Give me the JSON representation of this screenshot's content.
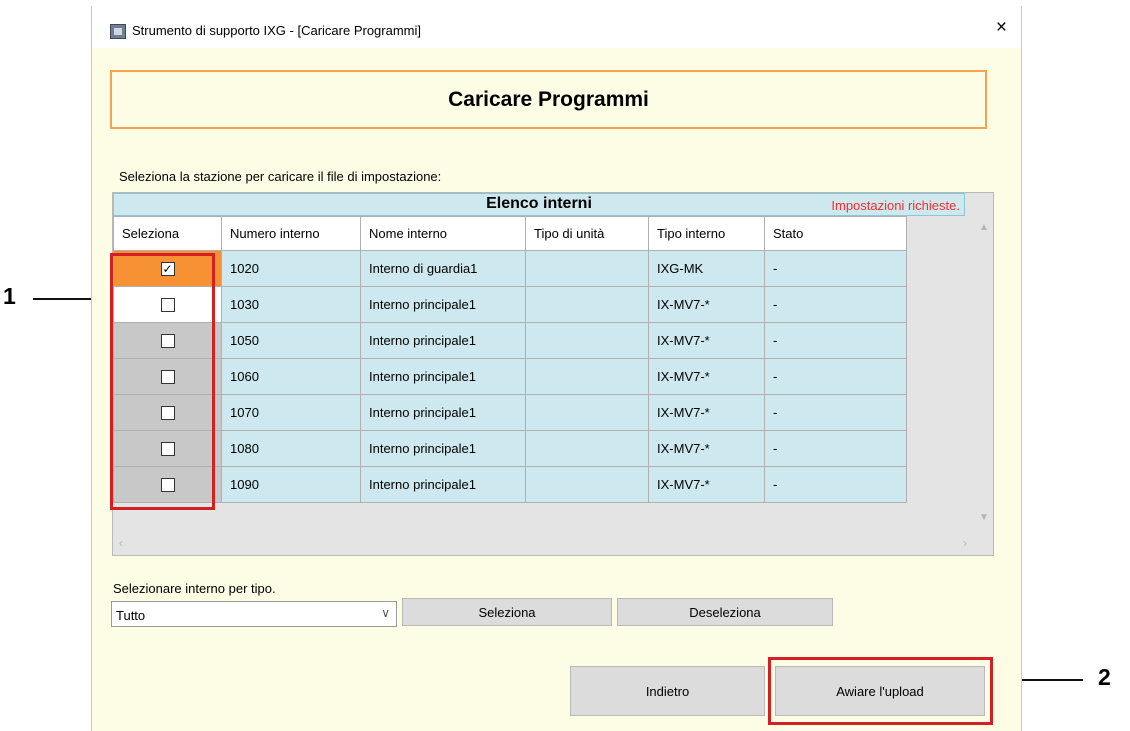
{
  "window": {
    "title": "Strumento di supporto IXG - [Caricare Programmi]",
    "close_glyph": "×"
  },
  "header": {
    "title": "Caricare Programmi"
  },
  "instruction": "Seleziona la stazione per caricare il file di impostazione:",
  "list": {
    "title": "Elenco interni",
    "required_note": "Impostazioni richieste.",
    "columns": [
      "Seleziona",
      "Numero interno",
      "Nome interno",
      "Tipo di unità",
      "Tipo interno",
      "Stato"
    ],
    "rows": [
      {
        "checked": true,
        "number": "1020",
        "name": "Interno di guardia1",
        "unit_type": "",
        "ext_type": "IXG-MK",
        "status": "-"
      },
      {
        "checked": false,
        "number": "1030",
        "name": "Interno principale1",
        "unit_type": "",
        "ext_type": "IX-MV7-*",
        "status": "-"
      },
      {
        "checked": false,
        "number": "1050",
        "name": "Interno principale1",
        "unit_type": "",
        "ext_type": "IX-MV7-*",
        "status": "-"
      },
      {
        "checked": false,
        "number": "1060",
        "name": "Interno principale1",
        "unit_type": "",
        "ext_type": "IX-MV7-*",
        "status": "-"
      },
      {
        "checked": false,
        "number": "1070",
        "name": "Interno principale1",
        "unit_type": "",
        "ext_type": "IX-MV7-*",
        "status": "-"
      },
      {
        "checked": false,
        "number": "1080",
        "name": "Interno principale1",
        "unit_type": "",
        "ext_type": "IX-MV7-*",
        "status": "-"
      },
      {
        "checked": false,
        "number": "1090",
        "name": "Interno principale1",
        "unit_type": "",
        "ext_type": "IX-MV7-*",
        "status": "-"
      }
    ]
  },
  "filter": {
    "label": "Selezionare interno per tipo.",
    "selected": "Tutto",
    "select_button": "Seleziona",
    "deselect_button": "Deseleziona"
  },
  "footer": {
    "back_button": "Indietro",
    "upload_button": "Awiare l'upload"
  },
  "callouts": [
    "1",
    "2"
  ],
  "colors": {
    "window_bg": "#fdfde6",
    "header_border": "#f6a34d",
    "list_bg": "#cde9ef",
    "selected_row": "#f69233",
    "highlight": "#d32022",
    "required_text": "#ff2a2a"
  }
}
